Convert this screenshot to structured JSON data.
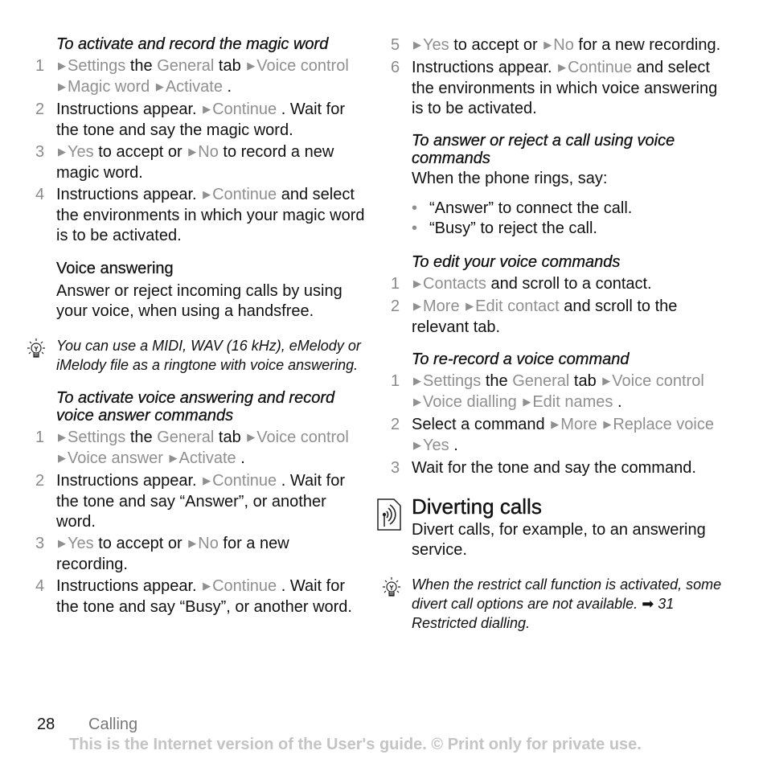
{
  "left_column": {
    "magic_word": {
      "heading": "To activate and record the magic word",
      "steps": [
        {
          "num": "1",
          "parts": [
            {
              "t": "menu",
              "v": "Settings"
            },
            {
              "t": "text",
              "v": " the "
            },
            {
              "t": "menu-plain",
              "v": "General"
            },
            {
              "t": "text",
              "v": " tab "
            },
            {
              "t": "menu",
              "v": "Voice control"
            },
            {
              "t": "menu",
              "v": "Magic word"
            },
            {
              "t": "menu",
              "v": "Activate"
            },
            {
              "t": "text",
              "v": "."
            }
          ]
        },
        {
          "num": "2",
          "parts": [
            {
              "t": "text",
              "v": "Instructions appear. "
            },
            {
              "t": "menu",
              "v": "Continue"
            },
            {
              "t": "text",
              "v": ". Wait for the tone and say the magic word."
            }
          ]
        },
        {
          "num": "3",
          "parts": [
            {
              "t": "menu",
              "v": "Yes"
            },
            {
              "t": "text",
              "v": " to accept or "
            },
            {
              "t": "menu",
              "v": "No"
            },
            {
              "t": "text",
              "v": " to record a new magic word."
            }
          ]
        },
        {
          "num": "4",
          "parts": [
            {
              "t": "text",
              "v": "Instructions appear. "
            },
            {
              "t": "menu",
              "v": "Continue"
            },
            {
              "t": "text",
              "v": " and select the environments in which your magic word is to be activated."
            }
          ]
        }
      ]
    },
    "voice_answering": {
      "title": "Voice answering",
      "description": "Answer or reject incoming calls by using your voice, when using a handsfree."
    },
    "tip_ringtone": "You can use a MIDI, WAV (16 kHz), eMelody or iMelody file as a ringtone with voice answering.",
    "activate_voice_answering": {
      "heading": "To activate voice answering and record voice answer commands",
      "steps": [
        {
          "num": "1",
          "parts": [
            {
              "t": "menu",
              "v": "Settings"
            },
            {
              "t": "text",
              "v": " the "
            },
            {
              "t": "menu-plain",
              "v": "General"
            },
            {
              "t": "text",
              "v": " tab "
            },
            {
              "t": "menu",
              "v": "Voice control"
            },
            {
              "t": "menu",
              "v": "Voice answer"
            },
            {
              "t": "menu",
              "v": "Activate"
            },
            {
              "t": "text",
              "v": "."
            }
          ]
        },
        {
          "num": "2",
          "parts": [
            {
              "t": "text",
              "v": "Instructions appear. "
            },
            {
              "t": "menu",
              "v": "Continue"
            },
            {
              "t": "text",
              "v": ". Wait for the tone and say “Answer”, or another word."
            }
          ]
        },
        {
          "num": "3",
          "parts": [
            {
              "t": "menu",
              "v": "Yes"
            },
            {
              "t": "text",
              "v": " to accept or "
            },
            {
              "t": "menu",
              "v": "No"
            },
            {
              "t": "text",
              "v": " for a new recording."
            }
          ]
        },
        {
          "num": "4",
          "parts": [
            {
              "t": "text",
              "v": "Instructions appear. "
            },
            {
              "t": "menu",
              "v": "Continue"
            },
            {
              "t": "text",
              "v": ". Wait for the tone and say “Busy”, or another word."
            }
          ]
        }
      ]
    }
  },
  "right_column": {
    "continued_steps": [
      {
        "num": "5",
        "parts": [
          {
            "t": "menu",
            "v": "Yes"
          },
          {
            "t": "text",
            "v": " to accept or "
          },
          {
            "t": "menu",
            "v": "No"
          },
          {
            "t": "text",
            "v": " for a new recording."
          }
        ]
      },
      {
        "num": "6",
        "parts": [
          {
            "t": "text",
            "v": "Instructions appear. "
          },
          {
            "t": "menu",
            "v": "Continue"
          },
          {
            "t": "text",
            "v": " and select the environments in which voice answering is to be activated."
          }
        ]
      }
    ],
    "answer_reject": {
      "heading": "To answer or reject a call using voice commands",
      "intro": "When the phone rings, say:",
      "bullets": [
        "“Answer” to connect the call.",
        "“Busy” to reject the call."
      ]
    },
    "edit_commands": {
      "heading": "To edit your voice commands",
      "steps": [
        {
          "num": "1",
          "parts": [
            {
              "t": "menu",
              "v": "Contacts"
            },
            {
              "t": "text",
              "v": " and scroll to a contact."
            }
          ]
        },
        {
          "num": "2",
          "parts": [
            {
              "t": "menu",
              "v": "More"
            },
            {
              "t": "menu",
              "v": "Edit contact"
            },
            {
              "t": "text",
              "v": " and scroll to the relevant tab."
            }
          ]
        }
      ]
    },
    "rerecord": {
      "heading": "To re-record a voice command",
      "steps": [
        {
          "num": "1",
          "parts": [
            {
              "t": "menu",
              "v": "Settings"
            },
            {
              "t": "text",
              "v": " the "
            },
            {
              "t": "menu-plain",
              "v": "General"
            },
            {
              "t": "text",
              "v": " tab "
            },
            {
              "t": "menu",
              "v": "Voice control"
            },
            {
              "t": "menu",
              "v": "Voice dialling"
            },
            {
              "t": "menu",
              "v": "Edit names"
            },
            {
              "t": "text",
              "v": "."
            }
          ]
        },
        {
          "num": "2",
          "parts": [
            {
              "t": "text",
              "v": "Select a command "
            },
            {
              "t": "menu",
              "v": "More"
            },
            {
              "t": "menu",
              "v": "Replace voice"
            },
            {
              "t": "menu",
              "v": "Yes"
            },
            {
              "t": "text",
              "v": "."
            }
          ]
        },
        {
          "num": "3",
          "parts": [
            {
              "t": "text",
              "v": "Wait for the tone and say the command."
            }
          ]
        }
      ]
    },
    "diverting": {
      "title": "Diverting calls",
      "icon": "network-signal-icon",
      "description": "Divert calls, for example, to an answering service."
    },
    "tip_divert": {
      "text": "When the restrict call function is activated, some divert call options are not available.",
      "ref_page": "31",
      "ref_title": "Restricted dialling."
    }
  },
  "footer": {
    "page_number": "28",
    "section": "Calling",
    "notice": "This is the Internet version of the User's guide. © Print only for private use."
  },
  "colors": {
    "text": "#111111",
    "menu_item": "#8f8f8f",
    "notice": "#c4c4c4"
  },
  "icons": {
    "tip": "lightbulb-icon",
    "menu_arrow": "▶",
    "bullet": "•",
    "reference": "➡"
  }
}
